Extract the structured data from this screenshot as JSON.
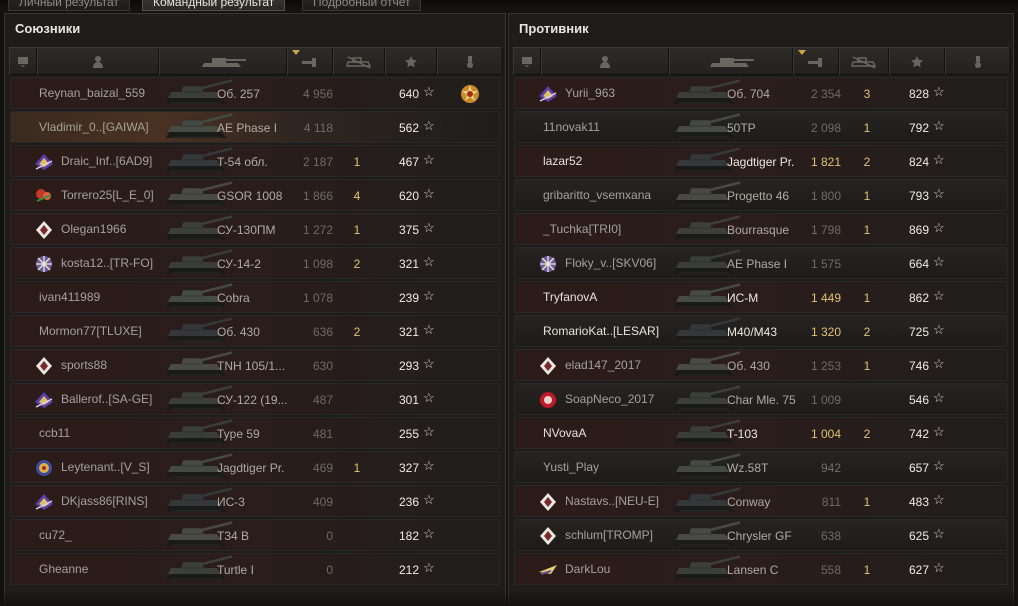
{
  "tabs": [
    {
      "label": "Личный результат",
      "active": false
    },
    {
      "label": "Командный результат",
      "active": true
    },
    {
      "label": "Подробный отчет",
      "active": false
    }
  ],
  "allies": {
    "title": "Союзники",
    "players": [
      {
        "name": "Reynan_baizal_559",
        "icon": "",
        "vehicle": "Об. 257",
        "damage": "4 956",
        "kills": "",
        "xp": "640",
        "medal": "order-medal",
        "style": "red"
      },
      {
        "name": "Vladimir_0..[GAIWA]",
        "icon": "",
        "vehicle": "AE Phase I",
        "damage": "4 118",
        "kills": "",
        "xp": "562",
        "medal": "",
        "style": "highlight"
      },
      {
        "name": "Draic_Inf..[6AD9]",
        "icon": "emblem-violet-icon",
        "vehicle": "T-54 обл.",
        "damage": "2 187",
        "kills": "1",
        "xp": "467",
        "medal": "",
        "style": "red"
      },
      {
        "name": "Torrero25[L_E_0]",
        "icon": "emblem-flower-icon",
        "vehicle": "GSOR 1008",
        "damage": "1 866",
        "kills": "4",
        "xp": "620",
        "medal": "",
        "style": "red"
      },
      {
        "name": "Olegan1966",
        "icon": "emblem-diamond-icon",
        "vehicle": "СУ-130ПМ",
        "damage": "1 272",
        "kills": "1",
        "xp": "375",
        "medal": "",
        "style": "red"
      },
      {
        "name": "kosta12..[TR-FO]",
        "icon": "emblem-snowflake-icon",
        "vehicle": "СУ-14-2",
        "damage": "1 098",
        "kills": "2",
        "xp": "321",
        "medal": "",
        "style": "red"
      },
      {
        "name": "ivan411989",
        "icon": "",
        "vehicle": "Cobra",
        "damage": "1 078",
        "kills": "",
        "xp": "239",
        "medal": "",
        "style": "red"
      },
      {
        "name": "Mormon77[TLUXE]",
        "icon": "",
        "vehicle": "Об. 430",
        "damage": "636",
        "kills": "2",
        "xp": "321",
        "medal": "",
        "style": "red"
      },
      {
        "name": "sports88",
        "icon": "emblem-diamond-icon",
        "vehicle": "TNH 105/1...",
        "damage": "630",
        "kills": "",
        "xp": "293",
        "medal": "",
        "style": "red"
      },
      {
        "name": "Ballerof..[SA-GE]",
        "icon": "emblem-violet-icon",
        "vehicle": "СУ-122 (19...",
        "damage": "487",
        "kills": "",
        "xp": "301",
        "medal": "",
        "style": "red"
      },
      {
        "name": "ccb11",
        "icon": "",
        "vehicle": "Type 59",
        "damage": "481",
        "kills": "",
        "xp": "255",
        "medal": "",
        "style": "red"
      },
      {
        "name": "Leytenant..[V_S]",
        "icon": "emblem-round-icon",
        "vehicle": "Jagdtiger Pr.",
        "damage": "469",
        "kills": "1",
        "xp": "327",
        "medal": "",
        "style": "red"
      },
      {
        "name": "DKjass86[RINS]",
        "icon": "emblem-violet-icon",
        "vehicle": "ИС-3",
        "damage": "409",
        "kills": "",
        "xp": "236",
        "medal": "",
        "style": "red"
      },
      {
        "name": "cu72_",
        "icon": "",
        "vehicle": "T34 B",
        "damage": "0",
        "kills": "",
        "xp": "182",
        "medal": "",
        "style": "red"
      },
      {
        "name": "Gheanne",
        "icon": "",
        "vehicle": "Turtle I",
        "damage": "0",
        "kills": "",
        "xp": "212",
        "medal": "",
        "style": "red"
      }
    ]
  },
  "enemies": {
    "title": "Противник",
    "players": [
      {
        "name": "Yurii_963",
        "icon": "emblem-violet-icon",
        "vehicle": "Об. 704",
        "damage": "2 354",
        "kills": "3",
        "xp": "828",
        "white": false,
        "gold": false
      },
      {
        "name": "11novak11",
        "icon": "",
        "vehicle": "50TP",
        "damage": "2 098",
        "kills": "1",
        "xp": "792",
        "white": false,
        "gold": false
      },
      {
        "name": "lazar52",
        "icon": "",
        "vehicle": "Jagdtiger Pr.",
        "damage": "1 821",
        "kills": "2",
        "xp": "824",
        "white": true,
        "gold": true
      },
      {
        "name": "gribaritto_vsemxana",
        "icon": "",
        "vehicle": "Progetto 46",
        "damage": "1 800",
        "kills": "1",
        "xp": "793",
        "white": false,
        "gold": false
      },
      {
        "name": "_Tuchka[TRI0]",
        "icon": "",
        "vehicle": "Bourrasque",
        "damage": "1 798",
        "kills": "1",
        "xp": "869",
        "white": false,
        "gold": false
      },
      {
        "name": "Floky_v..[SKV06]",
        "icon": "emblem-snowflake-icon",
        "vehicle": "AE Phase I",
        "damage": "1 575",
        "kills": "",
        "xp": "664",
        "white": false,
        "gold": false
      },
      {
        "name": "TryfanovA",
        "icon": "",
        "vehicle": "ИС-М",
        "damage": "1 449",
        "kills": "1",
        "xp": "862",
        "white": true,
        "gold": true
      },
      {
        "name": "RomarioKat..[LESAR]",
        "icon": "",
        "vehicle": "M40/M43",
        "damage": "1 320",
        "kills": "2",
        "xp": "725",
        "white": true,
        "gold": true
      },
      {
        "name": "elad147_2017",
        "icon": "emblem-diamond-icon",
        "vehicle": "Об. 430",
        "damage": "1 253",
        "kills": "1",
        "xp": "746",
        "white": false,
        "gold": false
      },
      {
        "name": "SoapNeco_2017",
        "icon": "emblem-red-round-icon",
        "vehicle": "Char Mle. 75",
        "damage": "1 009",
        "kills": "",
        "xp": "546",
        "white": false,
        "gold": false
      },
      {
        "name": "NVovaA",
        "icon": "",
        "vehicle": "T-103",
        "damage": "1 004",
        "kills": "2",
        "xp": "742",
        "white": true,
        "gold": true
      },
      {
        "name": "Yusti_Play",
        "icon": "",
        "vehicle": "Wz.58T",
        "damage": "942",
        "kills": "",
        "xp": "657",
        "white": false,
        "gold": false
      },
      {
        "name": "Nastavs..[NEU-E]",
        "icon": "emblem-diamond-icon",
        "vehicle": "Conway",
        "damage": "811",
        "kills": "1",
        "xp": "483",
        "white": false,
        "gold": false
      },
      {
        "name": "schlum[TROMP]",
        "icon": "emblem-diamond-icon",
        "vehicle": "Chrysler GF",
        "damage": "638",
        "kills": "",
        "xp": "625",
        "white": false,
        "gold": false
      },
      {
        "name": "DarkLou",
        "icon": "emblem-plane-icon",
        "vehicle": "Lansen C",
        "damage": "558",
        "kills": "1",
        "xp": "627",
        "white": false,
        "gold": false
      }
    ]
  },
  "columns": [
    "squad-icon",
    "player-icon",
    "tank-icon",
    "damage-icon",
    "kills-icon",
    "xp-star-icon",
    "medal-icon"
  ],
  "star_glyph": "☆"
}
